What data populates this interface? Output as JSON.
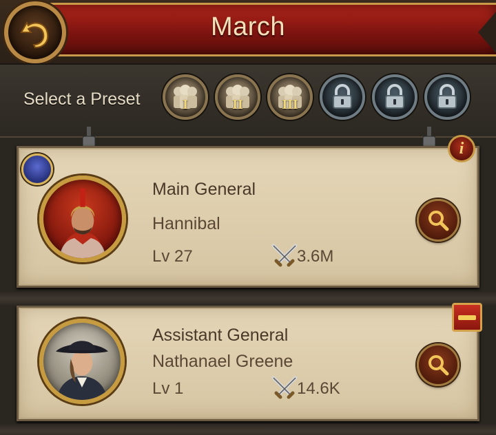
{
  "header": {
    "title": "March"
  },
  "presets": {
    "label": "Select a Preset",
    "items": [
      {
        "numeral": "I",
        "state": "unlocked",
        "icon": "soldiers-icon"
      },
      {
        "numeral": "II",
        "state": "unlocked",
        "icon": "soldiers-icon"
      },
      {
        "numeral": "III",
        "state": "unlocked",
        "icon": "soldiers-icon"
      },
      {
        "numeral": "",
        "state": "locked",
        "icon": "lock-icon"
      },
      {
        "numeral": "",
        "state": "locked",
        "icon": "lock-icon"
      },
      {
        "numeral": "",
        "state": "locked",
        "icon": "lock-icon"
      }
    ]
  },
  "main_general": {
    "role": "Main General",
    "name": "Hannibal",
    "level": "Lv 27",
    "power": "3.6M"
  },
  "assistant_general": {
    "role": "Assistant General",
    "name": "Nathanael Greene",
    "level": "Lv 1",
    "power": "14.6K"
  },
  "colors": {
    "banner_red": "#8e1a12",
    "gold_trim": "#c89a4a",
    "card_bg": "#ddccaa",
    "text_brown": "#4a3828"
  }
}
